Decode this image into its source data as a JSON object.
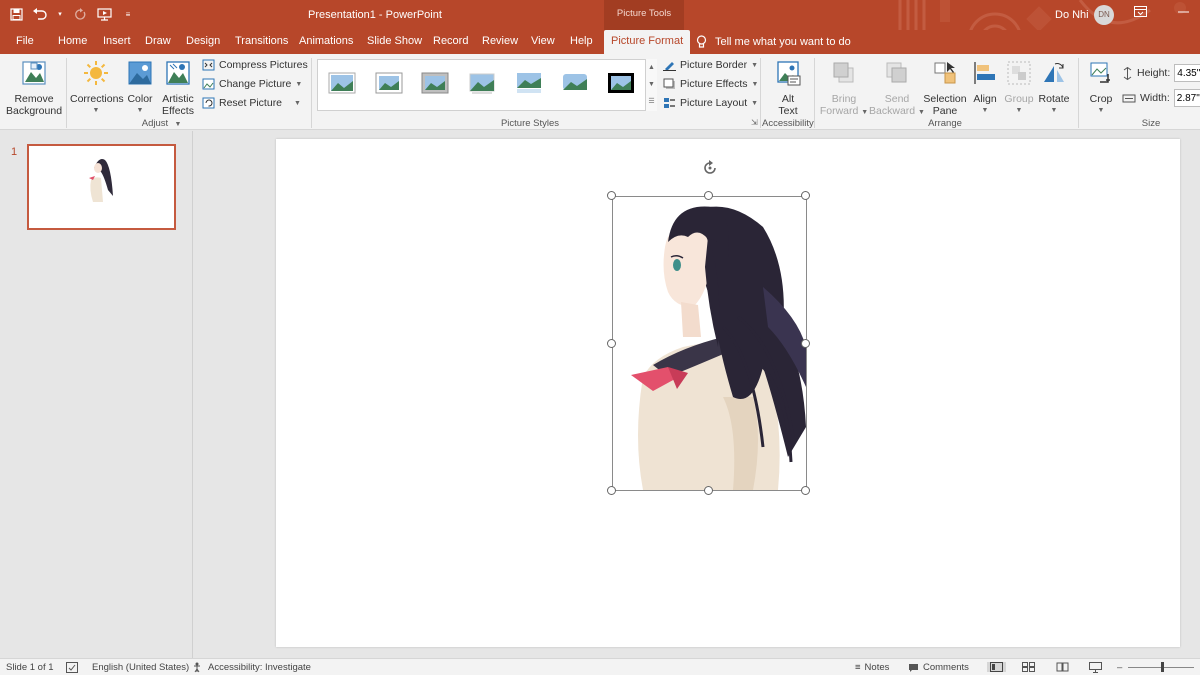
{
  "titlebar": {
    "doc_title": "Presentation1  -  PowerPoint",
    "context_tab": "Picture Tools",
    "user_name": "Do Nhi",
    "user_initials": "DN"
  },
  "tabs": [
    "File",
    "Home",
    "Insert",
    "Draw",
    "Design",
    "Transitions",
    "Animations",
    "Slide Show",
    "Record",
    "Review",
    "View",
    "Help",
    "Picture Format"
  ],
  "active_tab": "Picture Format",
  "tell_me": "Tell me what you want to do",
  "ribbon": {
    "remove_background": [
      "Remove",
      "Background"
    ],
    "corrections": "Corrections",
    "color": "Color",
    "artistic_effects": [
      "Artistic",
      "Effects"
    ],
    "compress_pictures": "Compress Pictures",
    "change_picture": "Change Picture",
    "reset_picture": "Reset Picture",
    "adjust_label": "Adjust",
    "picture_border": "Picture Border",
    "picture_effects": "Picture Effects",
    "picture_layout": "Picture Layout",
    "picture_styles_label": "Picture Styles",
    "alt_text": [
      "Alt",
      "Text"
    ],
    "accessibility_label": "Accessibility",
    "bring_forward": [
      "Bring",
      "Forward"
    ],
    "send_backward": [
      "Send",
      "Backward"
    ],
    "selection_pane": [
      "Selection",
      "Pane"
    ],
    "align": "Align",
    "group": "Group",
    "rotate": "Rotate",
    "arrange_label": "Arrange",
    "crop": "Crop",
    "height_label": "Height:",
    "height_value": "4.35\"",
    "width_label": "Width:",
    "width_value": "2.87\"",
    "size_label": "Size"
  },
  "thumbnails": {
    "slide_number": "1"
  },
  "statusbar": {
    "slide_info": "Slide 1 of 1",
    "language": "English (United States)",
    "accessibility": "Accessibility: Investigate",
    "notes": "Notes",
    "comments": "Comments"
  },
  "colors": {
    "accent": "#b7472a",
    "ribbon_bg": "#f3f3f3",
    "canvas_bg": "#e6e6e6"
  }
}
